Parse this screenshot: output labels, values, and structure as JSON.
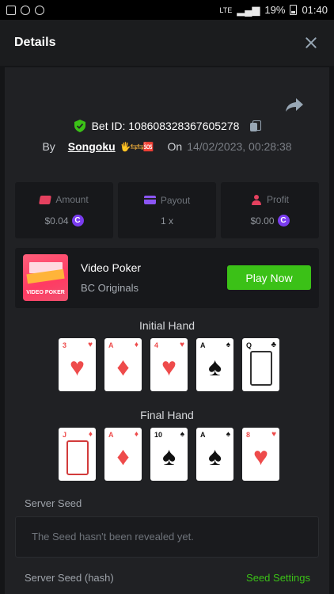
{
  "statusbar": {
    "battery": "19%",
    "time": "01:40",
    "network": "LTE"
  },
  "header": {
    "title": "Details"
  },
  "bet": {
    "id_text": "Bet ID: 108608328367605278",
    "by_label": "By",
    "username": "Songoku",
    "user_emojis": "🖐⇆⇆🆘",
    "on_label": "On",
    "date": "14/02/2023, 00:28:38"
  },
  "stats": [
    {
      "label": "Amount",
      "value": "$0.04",
      "coin": "C"
    },
    {
      "label": "Payout",
      "value": "1 x"
    },
    {
      "label": "Profit",
      "value": "$0.00",
      "coin": "C"
    }
  ],
  "game": {
    "thumb_text": "VIDEO POKER",
    "title": "Video Poker",
    "subtitle": "BC Originals",
    "play_label": "Play Now"
  },
  "initial_hand": {
    "title": "Initial Hand",
    "cards": [
      {
        "rank": "3",
        "suit": "♥",
        "color": "red"
      },
      {
        "rank": "A",
        "suit": "♦",
        "color": "red"
      },
      {
        "rank": "4",
        "suit": "♥",
        "color": "red"
      },
      {
        "rank": "A",
        "suit": "♠",
        "color": "black"
      },
      {
        "rank": "Q",
        "suit": "♣",
        "color": "black"
      }
    ]
  },
  "final_hand": {
    "title": "Final Hand",
    "cards": [
      {
        "rank": "J",
        "suit": "♦",
        "color": "red"
      },
      {
        "rank": "A",
        "suit": "♦",
        "color": "red"
      },
      {
        "rank": "10",
        "suit": "♠",
        "color": "black"
      },
      {
        "rank": "A",
        "suit": "♠",
        "color": "black"
      },
      {
        "rank": "8",
        "suit": "♥",
        "color": "red"
      }
    ]
  },
  "server_seed": {
    "label": "Server Seed",
    "value": "The Seed hasn't been revealed yet."
  },
  "server_seed_hash": {
    "label": "Server Seed (hash)",
    "settings_label": "Seed Settings"
  },
  "colors": {
    "accent_green": "#3bc117",
    "coin_purple": "#7a3cf0",
    "red": "#ee4b4b"
  }
}
